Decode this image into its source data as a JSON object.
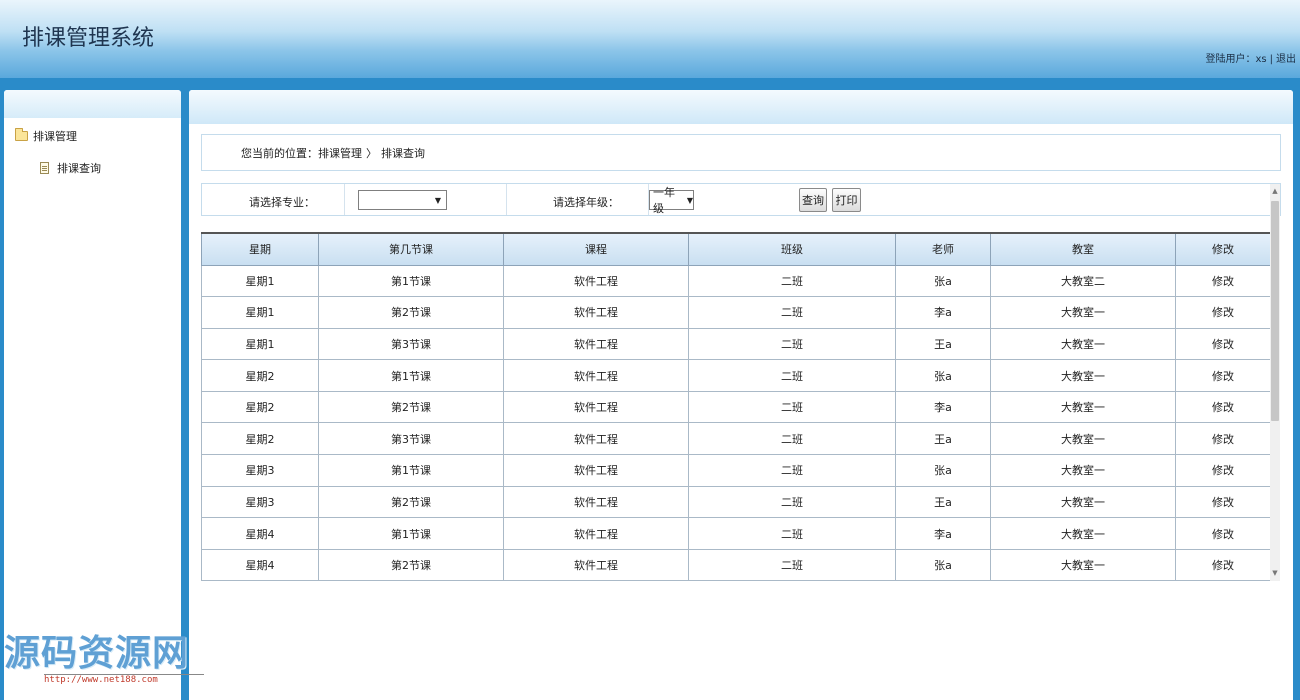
{
  "header": {
    "app_title": "排课管理系统",
    "user_label": "登陆用户：",
    "user_name": "xs",
    "separator": "|",
    "logout": "退出"
  },
  "sidebar": {
    "root": "排课管理",
    "child": "排课查询"
  },
  "breadcrumb": {
    "prefix": "您当前的位置：",
    "level1": "排课管理",
    "arrow": "〉",
    "level2": "排课查询"
  },
  "filters": {
    "major_label": "请选择专业：",
    "major_value": "",
    "grade_label": "请选择年级：",
    "grade_value": "一年级",
    "query_button": "查询",
    "print_button": "打印"
  },
  "table": {
    "headers": [
      "星期",
      "第几节课",
      "课程",
      "班级",
      "老师",
      "教室",
      "修改"
    ],
    "rows": [
      [
        "星期1",
        "第1节课",
        "软件工程",
        "二班",
        "张a",
        "大教室二",
        "修改"
      ],
      [
        "星期1",
        "第2节课",
        "软件工程",
        "二班",
        "李a",
        "大教室一",
        "修改"
      ],
      [
        "星期1",
        "第3节课",
        "软件工程",
        "二班",
        "王a",
        "大教室一",
        "修改"
      ],
      [
        "星期2",
        "第1节课",
        "软件工程",
        "二班",
        "张a",
        "大教室一",
        "修改"
      ],
      [
        "星期2",
        "第2节课",
        "软件工程",
        "二班",
        "李a",
        "大教室一",
        "修改"
      ],
      [
        "星期2",
        "第3节课",
        "软件工程",
        "二班",
        "王a",
        "大教室一",
        "修改"
      ],
      [
        "星期3",
        "第1节课",
        "软件工程",
        "二班",
        "张a",
        "大教室一",
        "修改"
      ],
      [
        "星期3",
        "第2节课",
        "软件工程",
        "二班",
        "王a",
        "大教室一",
        "修改"
      ],
      [
        "星期4",
        "第1节课",
        "软件工程",
        "二班",
        "李a",
        "大教室一",
        "修改"
      ],
      [
        "星期4",
        "第2节课",
        "软件工程",
        "二班",
        "张a",
        "大教室一",
        "修改"
      ]
    ]
  },
  "watermark": {
    "text": "源码资源网",
    "url": "http://www.net188.com"
  },
  "colors": {
    "header_blue": "#5aa8dc",
    "frame_blue": "#2a8bc9",
    "watermark_blue": "#5fa0d4"
  },
  "icons": {
    "folder": "folder-open-icon",
    "document": "document-icon",
    "dropdown": "chevron-down-icon"
  }
}
